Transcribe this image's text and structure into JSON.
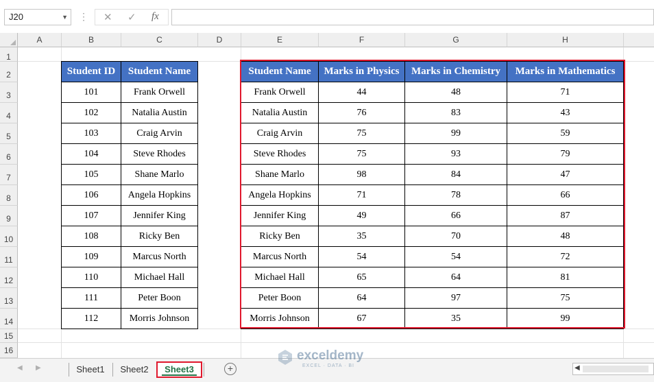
{
  "formula_bar": {
    "name_box": "J20",
    "cancel_icon": "✕",
    "enter_icon": "✓",
    "function_icon": "fx",
    "formula": ""
  },
  "columns": [
    "A",
    "B",
    "C",
    "D",
    "E",
    "F",
    "G",
    "H"
  ],
  "rows": [
    "1",
    "2",
    "3",
    "4",
    "5",
    "6",
    "7",
    "8",
    "9",
    "10",
    "11",
    "12",
    "13",
    "14",
    "15",
    "16"
  ],
  "table1": {
    "headers": [
      "Student ID",
      "Student Name"
    ],
    "rows": [
      [
        "101",
        "Frank Orwell"
      ],
      [
        "102",
        "Natalia Austin"
      ],
      [
        "103",
        "Craig Arvin"
      ],
      [
        "104",
        "Steve Rhodes"
      ],
      [
        "105",
        "Shane Marlo"
      ],
      [
        "106",
        "Angela Hopkins"
      ],
      [
        "107",
        "Jennifer King"
      ],
      [
        "108",
        "Ricky Ben"
      ],
      [
        "109",
        "Marcus North"
      ],
      [
        "110",
        "Michael Hall"
      ],
      [
        "111",
        "Peter Boon"
      ],
      [
        "112",
        "Morris Johnson"
      ]
    ]
  },
  "table2": {
    "headers": [
      "Student Name",
      "Marks in Physics",
      "Marks in Chemistry",
      "Marks in Mathematics"
    ],
    "rows": [
      [
        "Frank Orwell",
        "44",
        "48",
        "71"
      ],
      [
        "Natalia Austin",
        "76",
        "83",
        "43"
      ],
      [
        "Craig Arvin",
        "75",
        "99",
        "59"
      ],
      [
        "Steve Rhodes",
        "75",
        "93",
        "79"
      ],
      [
        "Shane Marlo",
        "98",
        "84",
        "47"
      ],
      [
        "Angela Hopkins",
        "71",
        "78",
        "66"
      ],
      [
        "Jennifer King",
        "49",
        "66",
        "87"
      ],
      [
        "Ricky Ben",
        "35",
        "70",
        "48"
      ],
      [
        "Marcus North",
        "54",
        "54",
        "72"
      ],
      [
        "Michael Hall",
        "65",
        "64",
        "81"
      ],
      [
        "Peter Boon",
        "64",
        "97",
        "75"
      ],
      [
        "Morris Johnson",
        "67",
        "35",
        "99"
      ]
    ]
  },
  "sheets": [
    "Sheet1",
    "Sheet2",
    "Sheet3"
  ],
  "active_sheet": "Sheet3",
  "watermark": {
    "title": "exceldemy",
    "subtitle": "EXCEL · DATA · BI"
  },
  "colors": {
    "header_fill": "#4472c4",
    "highlight": "#e0182d",
    "active_tab_text": "#217346"
  }
}
